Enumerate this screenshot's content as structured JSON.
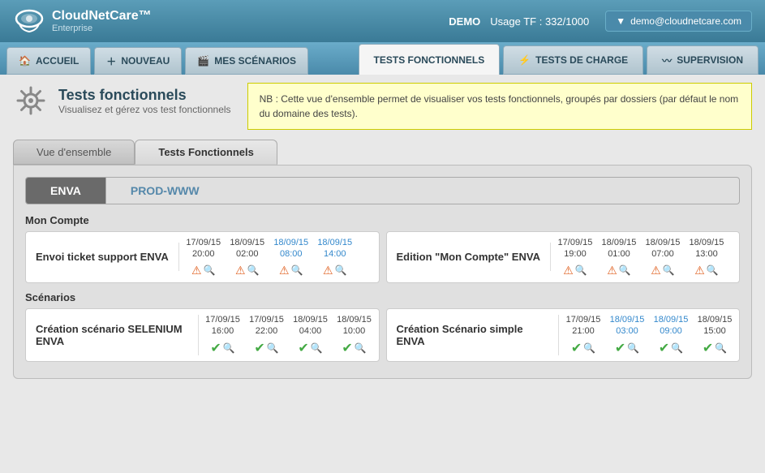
{
  "header": {
    "logo_name": "CloudNetCare™",
    "logo_sub": "Enterprise",
    "demo_label": "DEMO",
    "usage_label": "Usage TF : 332/1000",
    "user_email": "demo@cloudnetcare.com"
  },
  "navbar": {
    "btn_accueil": "ACCUEIL",
    "btn_nouveau": "NOUVEAU",
    "btn_scenarios": "MES SCÉNARIOS",
    "tab_fonctionnels": "TESTS FONCTIONNELS",
    "tab_charge": "TESTS DE CHARGE",
    "tab_supervision": "SUPERVISION"
  },
  "page": {
    "title": "Tests fonctionnels",
    "subtitle": "Visualisez et gérez vos test fonctionnels",
    "notice": "NB : Cette vue d'ensemble permet de visualiser vos tests fonctionnels, groupés par dossiers (par défaut le nom du domaine des tests)."
  },
  "sub_tabs": [
    {
      "label": "Vue d'ensemble",
      "active": false
    },
    {
      "label": "Tests Fonctionnels",
      "active": true
    }
  ],
  "env_tabs": [
    {
      "label": "ENVA",
      "active": true
    },
    {
      "label": "PROD-WWW",
      "active": false
    }
  ],
  "groups": [
    {
      "label": "Mon Compte",
      "tests": [
        {
          "name": "Envoi ticket support ENVA",
          "runs": [
            {
              "date": "17/09/15",
              "time": "20:00",
              "blue": false,
              "status": "warn"
            },
            {
              "date": "18/09/15",
              "time": "02:00",
              "blue": false,
              "status": "warn"
            },
            {
              "date": "18/09/15",
              "time": "08:00",
              "blue": true,
              "status": "warn"
            },
            {
              "date": "18/09/15",
              "time": "14:00",
              "blue": true,
              "status": "warn"
            }
          ]
        },
        {
          "name": "Edition \"Mon Compte\" ENVA",
          "runs": [
            {
              "date": "17/09/15",
              "time": "19:00",
              "blue": false,
              "status": "warn"
            },
            {
              "date": "18/09/15",
              "time": "01:00",
              "blue": false,
              "status": "warn"
            },
            {
              "date": "18/09/15",
              "time": "07:00",
              "blue": false,
              "status": "warn"
            },
            {
              "date": "18/09/15",
              "time": "13:00",
              "blue": false,
              "status": "warn"
            }
          ]
        }
      ]
    },
    {
      "label": "Scénarios",
      "tests": [
        {
          "name": "Création scénario SELENIUM ENVA",
          "runs": [
            {
              "date": "17/09/15",
              "time": "16:00",
              "blue": false,
              "status": "ok"
            },
            {
              "date": "17/09/15",
              "time": "22:00",
              "blue": false,
              "status": "ok"
            },
            {
              "date": "18/09/15",
              "time": "04:00",
              "blue": false,
              "status": "ok"
            },
            {
              "date": "18/09/15",
              "time": "10:00",
              "blue": false,
              "status": "ok"
            }
          ]
        },
        {
          "name": "Création Scénario simple ENVA",
          "runs": [
            {
              "date": "17/09/15",
              "time": "21:00",
              "blue": false,
              "status": "ok"
            },
            {
              "date": "18/09/15",
              "time": "03:00",
              "blue": true,
              "status": "ok"
            },
            {
              "date": "18/09/15",
              "time": "09:00",
              "blue": true,
              "status": "ok"
            },
            {
              "date": "18/09/15",
              "time": "15:00",
              "blue": false,
              "status": "ok"
            }
          ]
        }
      ]
    }
  ]
}
